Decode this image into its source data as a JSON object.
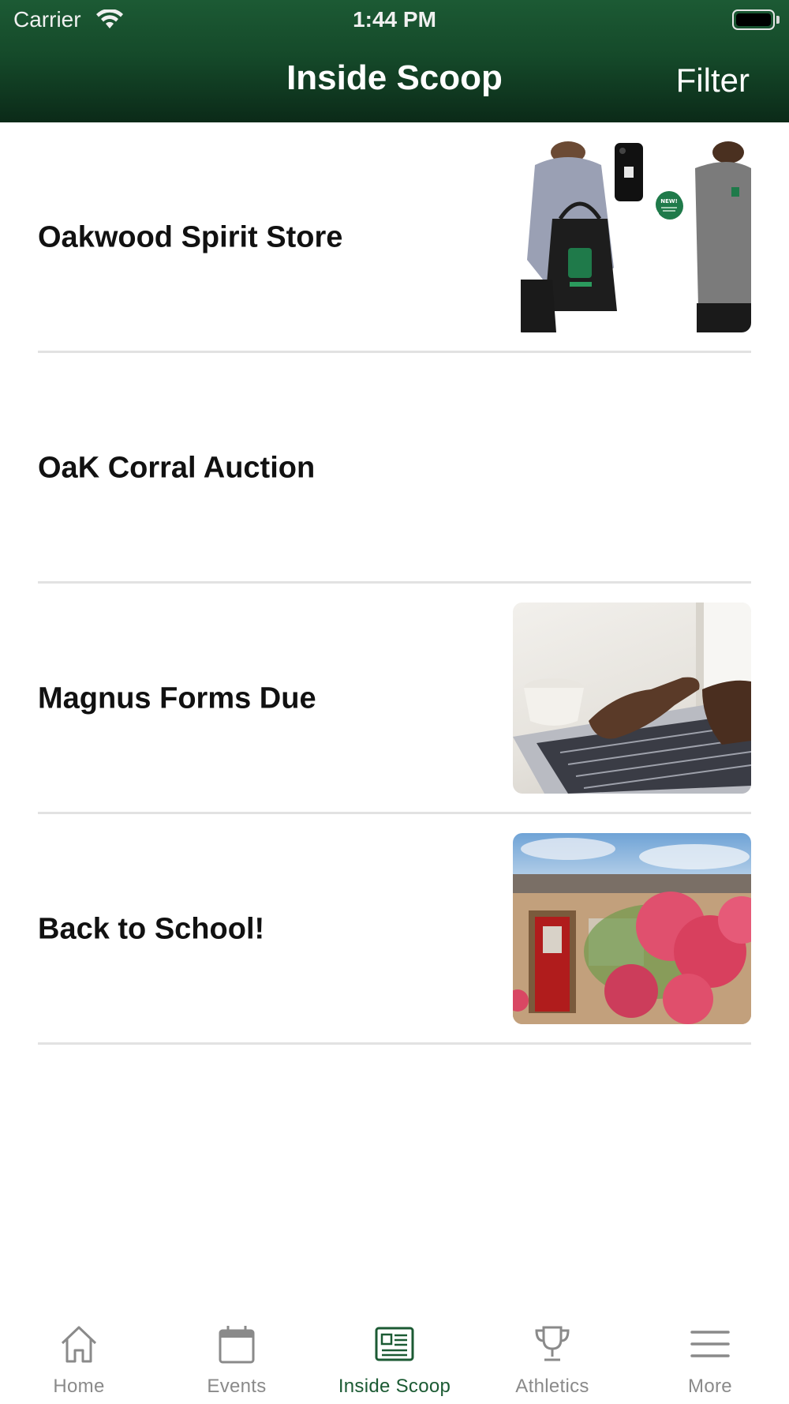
{
  "status_bar": {
    "carrier": "Carrier",
    "time": "1:44 PM"
  },
  "header": {
    "title": "Inside Scoop",
    "filter_label": "Filter"
  },
  "colors": {
    "brand_green": "#1b5a33",
    "inactive_gray": "#8a8a8a"
  },
  "items": [
    {
      "title": "Oakwood Spirit Store",
      "has_image": true,
      "image": "spirit-store-merch"
    },
    {
      "title": "OaK Corral Auction",
      "has_image": false
    },
    {
      "title": "Magnus Forms Due",
      "has_image": true,
      "image": "laptop-typing"
    },
    {
      "title": "Back to School!",
      "has_image": true,
      "image": "school-flowers"
    }
  ],
  "tabs": [
    {
      "label": "Home",
      "icon": "home-icon",
      "active": false
    },
    {
      "label": "Events",
      "icon": "calendar-icon",
      "active": false
    },
    {
      "label": "Inside Scoop",
      "icon": "newspaper-icon",
      "active": true
    },
    {
      "label": "Athletics",
      "icon": "trophy-icon",
      "active": false
    },
    {
      "label": "More",
      "icon": "menu-icon",
      "active": false
    }
  ]
}
